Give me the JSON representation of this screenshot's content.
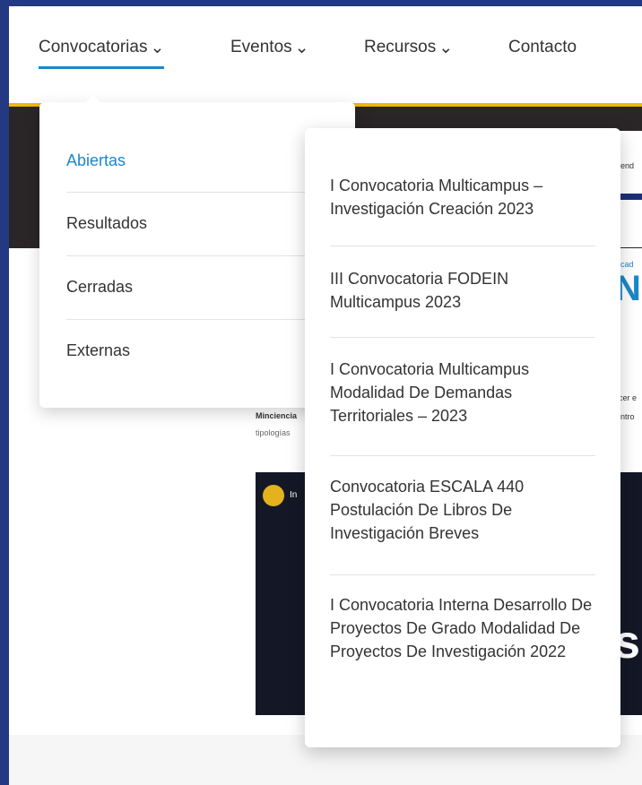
{
  "nav": {
    "items": [
      {
        "label": "Convocatorias",
        "chevron": "⌄"
      },
      {
        "label": "Eventos",
        "chevron": "⌄"
      },
      {
        "label": "Recursos",
        "chevron": "⌄"
      },
      {
        "label": "Contacto"
      }
    ],
    "accent_color": "#1a88c9",
    "brand_yellow": "#f2b705"
  },
  "dropdown": {
    "items": [
      {
        "label": "Abiertas"
      },
      {
        "label": "Resultados"
      },
      {
        "label": "Cerradas"
      },
      {
        "label": "Externas"
      }
    ]
  },
  "submenu": {
    "items": [
      {
        "label": "I Convocatoria Multicampus – Investigación Creación 2023"
      },
      {
        "label": "III Convocatoria FODEIN Multicampus 2023"
      },
      {
        "label": "I Convocatoria Multicampus Modalidad De Demandas Territoriales – 2023"
      },
      {
        "label": "Convocatoria ESCALA 440 Postulación De Libros De Investigación Breves"
      },
      {
        "label": "I Convocatoria Interna Desarrollo De Proyectos De Grado Modalidad De Proyectos De Investigación 2022"
      }
    ]
  },
  "background": {
    "heading_fragment": "Nc",
    "text_minciencias": "Minciencia",
    "text_tipologias": "tipologías",
    "text_calendar": "lend",
    "text_clase": "icad",
    "text_right1": "cer e",
    "text_right2": "intro",
    "video_letter": "s",
    "video_label": "In"
  }
}
